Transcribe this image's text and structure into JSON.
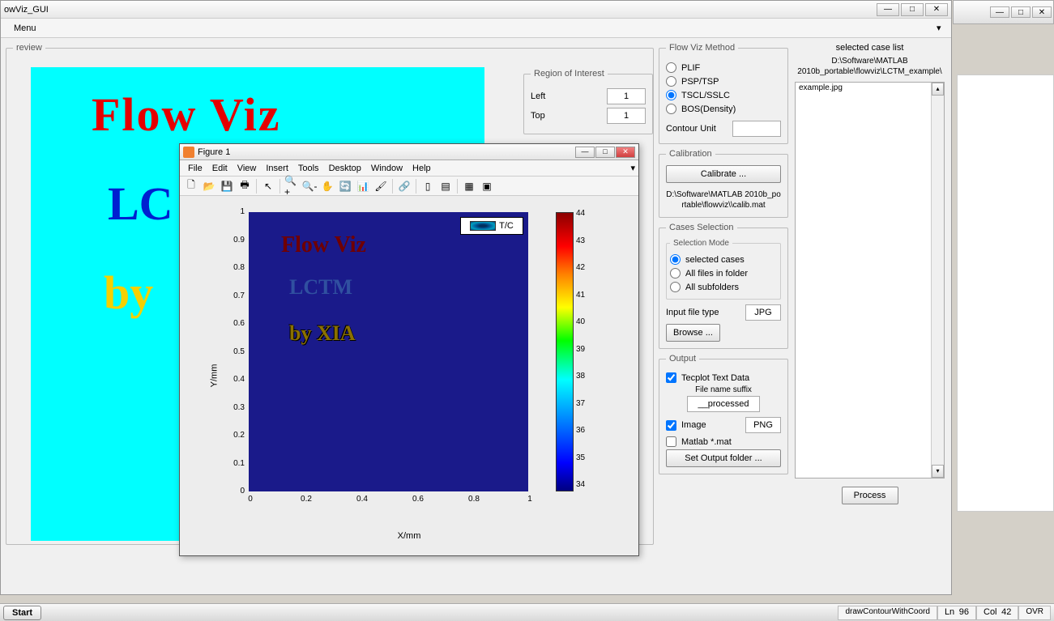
{
  "main": {
    "title": "owViz_GUI",
    "menu": "Menu"
  },
  "preview": {
    "legend": "review",
    "text1": "Flow  Viz",
    "text2": "LC",
    "text3": "by"
  },
  "roi": {
    "legend": "Region of Interest",
    "left_label": "Left",
    "left_val": "1",
    "top_label": "Top",
    "top_val": "1"
  },
  "flowviz": {
    "legend": "Flow Viz Method",
    "opt1": "PLIF",
    "opt2": "PSP/TSP",
    "opt3": "TSCL/SSLC",
    "opt4": "BOS(Density)",
    "contour_label": "Contour Unit",
    "contour_val": ""
  },
  "calib": {
    "legend": "Calibration",
    "btn": "Calibrate ...",
    "path": "D:\\Software\\MATLAB 2010b_portable\\flowviz\\\\calib.mat"
  },
  "cases": {
    "legend": "Cases Selection",
    "mode_legend": "Selection Mode",
    "opt1": "selected cases",
    "opt2": "All files in folder",
    "opt3": "All subfolders",
    "filetype_label": "Input file type",
    "filetype_val": "JPG",
    "browse": "Browse ..."
  },
  "output": {
    "legend": "Output",
    "chk1": "Tecplot Text Data",
    "suffix_label": "File name suffix",
    "suffix_val": "__processed",
    "chk2": "Image",
    "img_fmt": "PNG",
    "chk3": "Matlab *.mat",
    "set_folder": "Set Output folder ..."
  },
  "caselist": {
    "label": "selected case list",
    "path": "D:\\Software\\MATLAB 2010b_portable\\flowviz\\LCTM_example\\",
    "item1": "example.jpg",
    "process": "Process"
  },
  "figure": {
    "title": "Figure 1",
    "menus": {
      "file": "File",
      "edit": "Edit",
      "view": "View",
      "insert": "Insert",
      "tools": "Tools",
      "desktop": "Desktop",
      "window": "Window",
      "help": "Help"
    },
    "img": {
      "t1": "Flow  Viz",
      "t2": "LCTM",
      "t3": "by XIA"
    },
    "legend_label": "T/C",
    "ylabel": "Y/mm",
    "xlabel": "X/mm"
  },
  "chart_data": {
    "type": "heatmap",
    "title": "",
    "xlabel": "X/mm",
    "ylabel": "Y/mm",
    "xlim": [
      0,
      1
    ],
    "ylim": [
      0,
      1
    ],
    "xticks": [
      0,
      0.2,
      0.4,
      0.6,
      0.8,
      1
    ],
    "yticks": [
      0,
      0.1,
      0.2,
      0.3,
      0.4,
      0.5,
      0.6,
      0.7,
      0.8,
      0.9,
      1
    ],
    "colorbar": {
      "label": "T/C",
      "min": 34,
      "max": 44,
      "ticks": [
        34,
        35,
        36,
        37,
        38,
        39,
        40,
        41,
        42,
        43,
        44
      ]
    },
    "legend": [
      "T/C"
    ],
    "note": "background field ~34 T/C (blue) with text overlay"
  },
  "taskbar": {
    "start": "Start",
    "func": "drawContourWithCoord",
    "ln_label": "Ln",
    "ln": "96",
    "col_label": "Col",
    "col": "42",
    "ovr": "OVR"
  }
}
